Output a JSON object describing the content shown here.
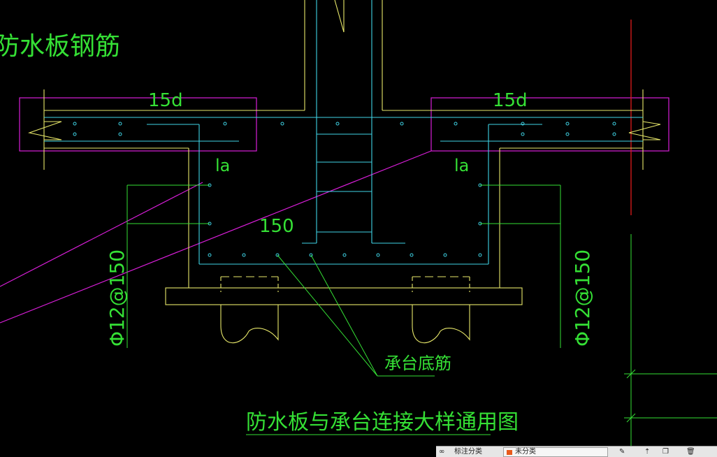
{
  "drawing": {
    "title_top": "防水板钢筋",
    "dim_left": "15d",
    "dim_right": "15d",
    "anchor_left": "la",
    "anchor_right": "la",
    "spacing": "150",
    "rebar_left": "Φ12@150",
    "rebar_right": "Φ12@150",
    "callout": "承台底筋",
    "caption": "防水板与承台连接大样通用图"
  },
  "colors": {
    "background": "#000000",
    "outline_yellow": "#e8e86a",
    "rebar_cyan": "#3fd4e6",
    "text_green": "#35e035",
    "boundary_magenta": "#d81ed8",
    "axis_red": "#e01b1b",
    "statusbar": "#e6e6e6"
  },
  "statusbar": {
    "left_label": "标注分类",
    "layer_value": "未分类"
  }
}
